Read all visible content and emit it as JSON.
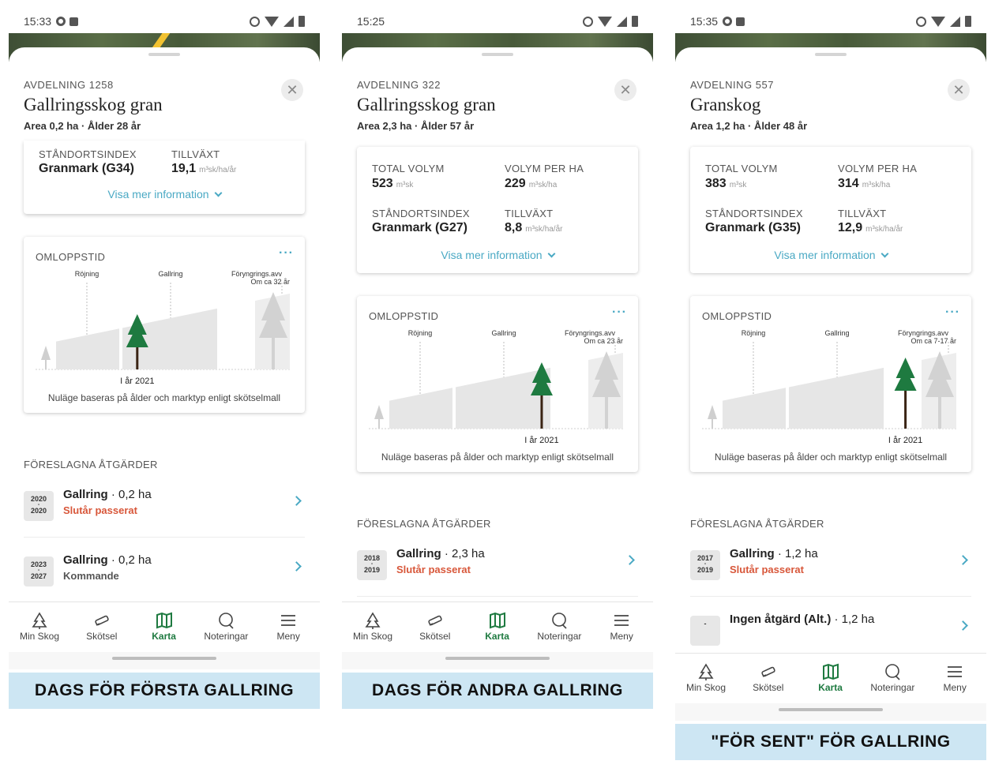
{
  "phones": [
    {
      "status_time": "15:33",
      "avdelning": "AVDELNING 1258",
      "title": "Gallringsskog gran",
      "subtitle": "Area 0,2 ha · Ålder 28 år",
      "card": {
        "standortsindex_label": "STÅNDORTSINDEX",
        "standortsindex_value": "Granmark (G34)",
        "tillvaxt_label": "TILLVÄXT",
        "tillvaxt_value": "19,1",
        "tillvaxt_unit": "m³sk/ha/år",
        "more_label": "Visa mer information"
      },
      "omlopp": {
        "title": "OMLOPPSTID",
        "menu": "···",
        "rojning": "Röjning",
        "gallring": "Gallring",
        "foryngring": "Föryngrings.avv",
        "om_ca": "Om ca 32 år",
        "year": "I år 2021",
        "note": "Nuläge baseras på ålder och marktyp enligt skötselmall",
        "position": 0.4
      },
      "section": "FÖRESLAGNA ÅTGÄRDER",
      "actions": [
        {
          "y1": "2020",
          "y2": "2020",
          "name": "Gallring",
          "area": " · 0,2 ha",
          "status": "Slutår passerat",
          "status_color": "#d8573a"
        },
        {
          "y1": "2023",
          "y2": "2027",
          "name": "Gallring",
          "area": " · 0,2 ha",
          "status": "Kommande",
          "status_color": "#555555"
        }
      ],
      "banner": "DAGS FÖR FÖRSTA GALLRING"
    },
    {
      "status_time": "15:25",
      "avdelning": "AVDELNING 322",
      "title": "Gallringsskog gran",
      "subtitle": "Area 2,3 ha · Ålder 57 år",
      "card": {
        "total_label": "TOTAL VOLYM",
        "total_value": "523",
        "total_unit": "m³sk",
        "per_ha_label": "VOLYM PER HA",
        "per_ha_value": "229",
        "per_ha_unit": "m³sk/ha",
        "standortsindex_label": "STÅNDORTSINDEX",
        "standortsindex_value": "Granmark (G27)",
        "tillvaxt_label": "TILLVÄXT",
        "tillvaxt_value": "8,8",
        "tillvaxt_unit": "m³sk/ha/år",
        "more_label": "Visa mer information"
      },
      "omlopp": {
        "title": "OMLOPPSTID",
        "menu": "···",
        "rojning": "Röjning",
        "gallring": "Gallring",
        "foryngring": "Föryngrings.avv",
        "om_ca": "Om ca 23 år",
        "year": "I år 2021",
        "note": "Nuläge baseras på ålder och marktyp enligt skötselmall",
        "position": 0.68
      },
      "section": "FÖRESLAGNA ÅTGÄRDER",
      "actions": [
        {
          "y1": "2018",
          "y2": "2019",
          "name": "Gallring",
          "area": " · 2,3 ha",
          "status": "Slutår passerat",
          "status_color": "#d8573a"
        }
      ],
      "banner": "DAGS FÖR ANDRA GALLRING"
    },
    {
      "status_time": "15:35",
      "avdelning": "AVDELNING 557",
      "title": "Granskog",
      "subtitle": "Area 1,2 ha · Ålder 48 år",
      "card": {
        "total_label": "TOTAL VOLYM",
        "total_value": "383",
        "total_unit": "m³sk",
        "per_ha_label": "VOLYM PER HA",
        "per_ha_value": "314",
        "per_ha_unit": "m³sk/ha",
        "standortsindex_label": "STÅNDORTSINDEX",
        "standortsindex_value": "Granmark (G35)",
        "tillvaxt_label": "TILLVÄXT",
        "tillvaxt_value": "12,9",
        "tillvaxt_unit": "m³sk/ha/år",
        "more_label": "Visa mer information"
      },
      "omlopp": {
        "title": "OMLOPPSTID",
        "menu": "···",
        "rojning": "Röjning",
        "gallring": "Gallring",
        "foryngring": "Föryngrings.avv",
        "om_ca": "Om ca 7-17 år",
        "year": "I år 2021",
        "note": "Nuläge baseras på ålder och marktyp enligt skötselmall",
        "position": 0.8
      },
      "section": "FÖRESLAGNA ÅTGÄRDER",
      "actions": [
        {
          "y1": "2017",
          "y2": "2019",
          "name": "Gallring",
          "area": " · 1,2 ha",
          "status": "Slutår passerat",
          "status_color": "#d8573a"
        },
        {
          "y1": "-",
          "y2": "",
          "name": "Ingen åtgärd (Alt.)",
          "area": " · 1,2 ha",
          "status": "",
          "status_color": "#555555"
        }
      ],
      "banner": "\"FÖR SENT\" FÖR GALLRING"
    }
  ],
  "nav": [
    {
      "label": "Min Skog",
      "icon": "tree-icon"
    },
    {
      "label": "Skötsel",
      "icon": "saw-icon"
    },
    {
      "label": "Karta",
      "icon": "map-icon"
    },
    {
      "label": "Noteringar",
      "icon": "note-icon"
    },
    {
      "label": "Meny",
      "icon": "menu-icon"
    }
  ],
  "colors": {
    "accent": "#4aa9c4",
    "active": "#1e7a40",
    "tree": "#1e7a40",
    "warning": "#d8573a",
    "banner": "#cde6f3"
  }
}
